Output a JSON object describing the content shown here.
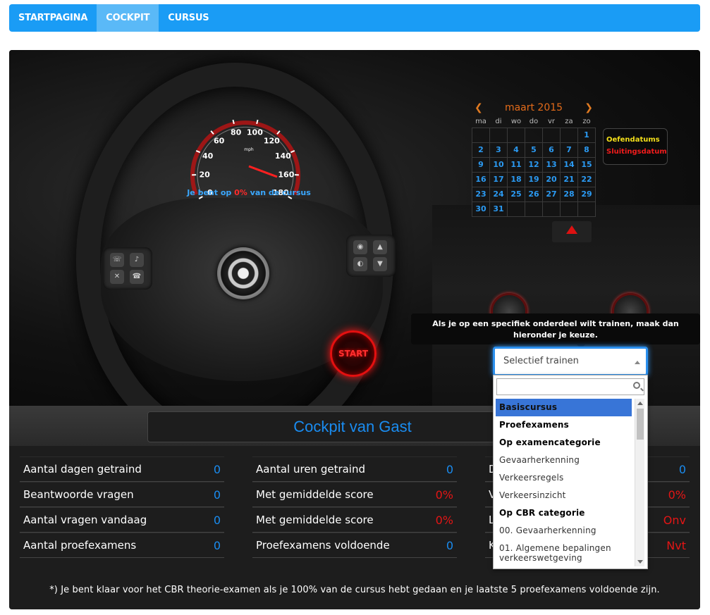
{
  "nav": {
    "items": [
      "STARTPAGINA",
      "COCKPIT",
      "CURSUS"
    ]
  },
  "gauge": {
    "ticks": [
      "0",
      "20",
      "40",
      "60",
      "80",
      "100",
      "120",
      "140",
      "160",
      "180"
    ],
    "unit": "mph",
    "progress_prefix": "Je bent op ",
    "progress_value": "0%",
    "progress_suffix": " van de cursus"
  },
  "calendar": {
    "month": "maart 2015",
    "weekdays": [
      "ma",
      "di",
      "wo",
      "do",
      "vr",
      "za",
      "zo"
    ],
    "weeks": [
      [
        "",
        "",
        "",
        "",
        "",
        "",
        "1"
      ],
      [
        "2",
        "3",
        "4",
        "5",
        "6",
        "7",
        "8"
      ],
      [
        "9",
        "10",
        "11",
        "12",
        "13",
        "14",
        "15"
      ],
      [
        "16",
        "17",
        "18",
        "19",
        "20",
        "21",
        "22"
      ],
      [
        "23",
        "24",
        "25",
        "26",
        "27",
        "28",
        "29"
      ],
      [
        "30",
        "31",
        "",
        "",
        "",
        "",
        ""
      ]
    ],
    "legend_practice": "Oefendatums",
    "legend_closing": "Sluitingsdatum"
  },
  "start_label": "START",
  "tooltip": "Als je op een specifiek onderdeel wilt trainen, maak dan hieronder je keuze.",
  "selector": {
    "placeholder": "Selectief trainen",
    "options": [
      {
        "label": "Basiscursus",
        "kind": "selected"
      },
      {
        "label": "Proefexamens",
        "kind": "group"
      },
      {
        "label": "Op examencategorie",
        "kind": "group"
      },
      {
        "label": "Gevaarherkenning",
        "kind": "item"
      },
      {
        "label": "Verkeersregels",
        "kind": "item"
      },
      {
        "label": "Verkeersinzicht",
        "kind": "item"
      },
      {
        "label": "Op CBR categorie",
        "kind": "group"
      },
      {
        "label": "00. Gevaarherkenning",
        "kind": "item"
      },
      {
        "label": "01. Algemene bepalingen verkeerswetgeving",
        "kind": "multi"
      }
    ]
  },
  "stats_title": "Cockpit van Gast",
  "stats": {
    "col1": [
      {
        "label": "Aantal dagen getraind",
        "value": "0",
        "color": "blue"
      },
      {
        "label": "Beantwoorde vragen",
        "value": "0",
        "color": "blue"
      },
      {
        "label": "Aantal vragen vandaag",
        "value": "0",
        "color": "blue"
      },
      {
        "label": "Aantal proefexamens",
        "value": "0",
        "color": "blue"
      }
    ],
    "col2": [
      {
        "label": "Aantal uren getraind",
        "value": "0",
        "color": "blue"
      },
      {
        "label": "Met gemiddelde score",
        "value": "0%",
        "color": "red"
      },
      {
        "label": "Met gemiddelde score",
        "value": "0%",
        "color": "red"
      },
      {
        "label": "Proefexamens voldoende",
        "value": "0",
        "color": "blue"
      }
    ],
    "col3": [
      {
        "label": "D",
        "value": "0",
        "color": "blue"
      },
      {
        "label": "V",
        "value": "0%",
        "color": "red"
      },
      {
        "label": "L",
        "value": "Onv",
        "color": "red"
      },
      {
        "label": "K",
        "value": "Nvt",
        "color": "red"
      }
    ]
  },
  "footnote": "*) Je bent klaar voor het CBR theorie-examen als je 100% van de cursus hebt gedaan en je laatste 5 proefexamens voldoende zijn.",
  "colors": {
    "nav": "#1a9cf5",
    "accent_blue": "#1a8cf0",
    "accent_red": "#e41515",
    "calendar_day": "#2b9af2"
  }
}
